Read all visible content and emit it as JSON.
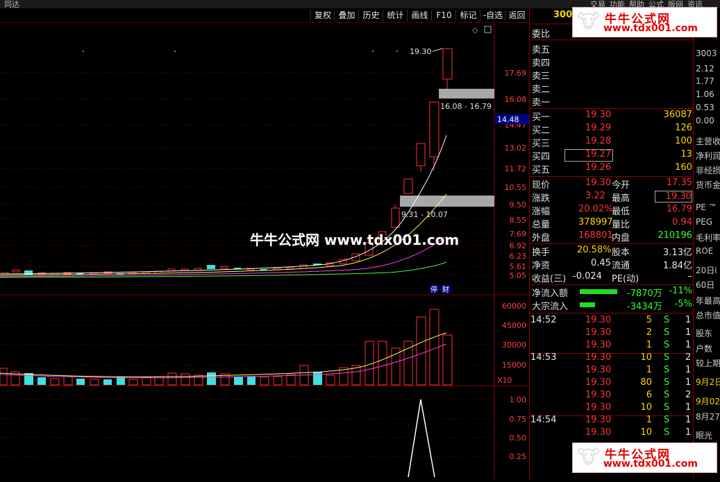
{
  "app": {
    "title": "同达",
    "menus": [
      "交易",
      "功能",
      "帮助",
      "公式",
      "版网",
      "资讯"
    ]
  },
  "toolbar": {
    "items": [
      "复权",
      "叠加",
      "历史",
      "统计",
      "画线",
      "F10",
      "标记",
      "-自选",
      "返回"
    ]
  },
  "main_chart": {
    "price_axis": [
      "17.69",
      "16.08",
      "14.47",
      "13.02",
      "11.72",
      "10.55",
      "9.50",
      "8.55",
      "7.69",
      "6.92",
      "6.23",
      "5.61",
      "5.05"
    ],
    "current_price_tag": "14.48",
    "high_label": "19.30",
    "zone_upper_label": "16.08 - 16.79",
    "zone_lower_label": "9.31 - 10.07",
    "badges": [
      "停",
      "财"
    ]
  },
  "volume_chart": {
    "axis": [
      "60000",
      "45000",
      "30000",
      "15000"
    ],
    "unit": "X10"
  },
  "indicator_chart": {
    "axis": [
      "1.00",
      "0.75",
      "0.50",
      "0.25"
    ]
  },
  "quote": {
    "code": "3003",
    "weibi_label": "委比",
    "sell_labels": [
      "卖五",
      "卖四",
      "卖三",
      "卖二",
      "卖一"
    ],
    "buy": [
      {
        "label": "买一",
        "price": "19.30",
        "vol": "36087"
      },
      {
        "label": "买二",
        "price": "19.29",
        "vol": "126"
      },
      {
        "label": "买三",
        "price": "19.28",
        "vol": "100"
      },
      {
        "label": "买四",
        "price": "19.27",
        "vol": "13"
      },
      {
        "label": "买五",
        "price": "19.26",
        "vol": "160"
      }
    ],
    "stats": [
      {
        "l1": "现价",
        "v1": "19.30",
        "l2": "今开",
        "v2": "17.35"
      },
      {
        "l1": "涨跌",
        "v1": "3.22",
        "l2": "最高",
        "v2": "19.30"
      },
      {
        "l1": "涨幅",
        "v1": "20.02%",
        "l2": "最低",
        "v2": "16.79"
      },
      {
        "l1": "总量",
        "v1": "378997",
        "l2": "量比",
        "v2": "0.94"
      },
      {
        "l1": "外盘",
        "v1": "168801",
        "l2": "内盘",
        "v2": "210196"
      }
    ],
    "stats2": [
      {
        "l1": "换手",
        "v1": "20.58%",
        "l2": "股本",
        "v2": "3.13亿"
      },
      {
        "l1": "净资",
        "v1": "0.45",
        "l2": "流通",
        "v2": "1.84亿"
      },
      {
        "l1": "收益(三)",
        "v1": "-0.024",
        "l2": "PE(动)",
        "v2": "–"
      }
    ],
    "flows": [
      {
        "label": "净流入额",
        "value": "-7870万",
        "pct": "-11%",
        "bar": 0.55
      },
      {
        "label": "大宗流入",
        "value": "-3434万",
        "pct": "-5%",
        "bar": 0.16
      }
    ],
    "ticks": [
      {
        "time": "14:52",
        "price": "19.30",
        "vol": "5",
        "side": "S",
        "n": "1"
      },
      {
        "time": "",
        "price": "19.30",
        "vol": "2",
        "side": "S",
        "n": "1"
      },
      {
        "time": "",
        "price": "19.30",
        "vol": "1",
        "side": "S",
        "n": "1"
      },
      {
        "time": "14:53",
        "price": "19.30",
        "vol": "10",
        "side": "S",
        "n": "2"
      },
      {
        "time": "",
        "price": "19.30",
        "vol": "1",
        "side": "S",
        "n": "1"
      },
      {
        "time": "",
        "price": "19.30",
        "vol": "80",
        "side": "S",
        "n": "1"
      },
      {
        "time": "",
        "price": "19.30",
        "vol": "6",
        "side": "S",
        "n": "2"
      },
      {
        "time": "",
        "price": "19.30",
        "vol": "10",
        "side": "S",
        "n": "1"
      },
      {
        "time": "14:54",
        "price": "19.30",
        "vol": "1",
        "side": "S",
        "n": "1"
      },
      {
        "time": "",
        "price": "19.30",
        "vol": "10",
        "side": "S",
        "n": "1"
      }
    ]
  },
  "far_panel": {
    "items": [
      "3003",
      "2.12",
      "1.77",
      "1.06",
      "0.53",
      "0.00",
      "主营收",
      "净利润",
      "非经损",
      "货币金",
      "PE ™",
      "PEG",
      "毛利率",
      "ROE",
      "20日i",
      "60日",
      "年最高",
      "总市值",
      "股东",
      "户数",
      "较上期",
      "9月2日",
      "9月02",
      "8月27",
      "眼光"
    ]
  },
  "watermark": {
    "text": "牛牛公式网",
    "url": "www.tdx001.com",
    "center": "牛牛公式网 www.tdx001.com"
  }
}
